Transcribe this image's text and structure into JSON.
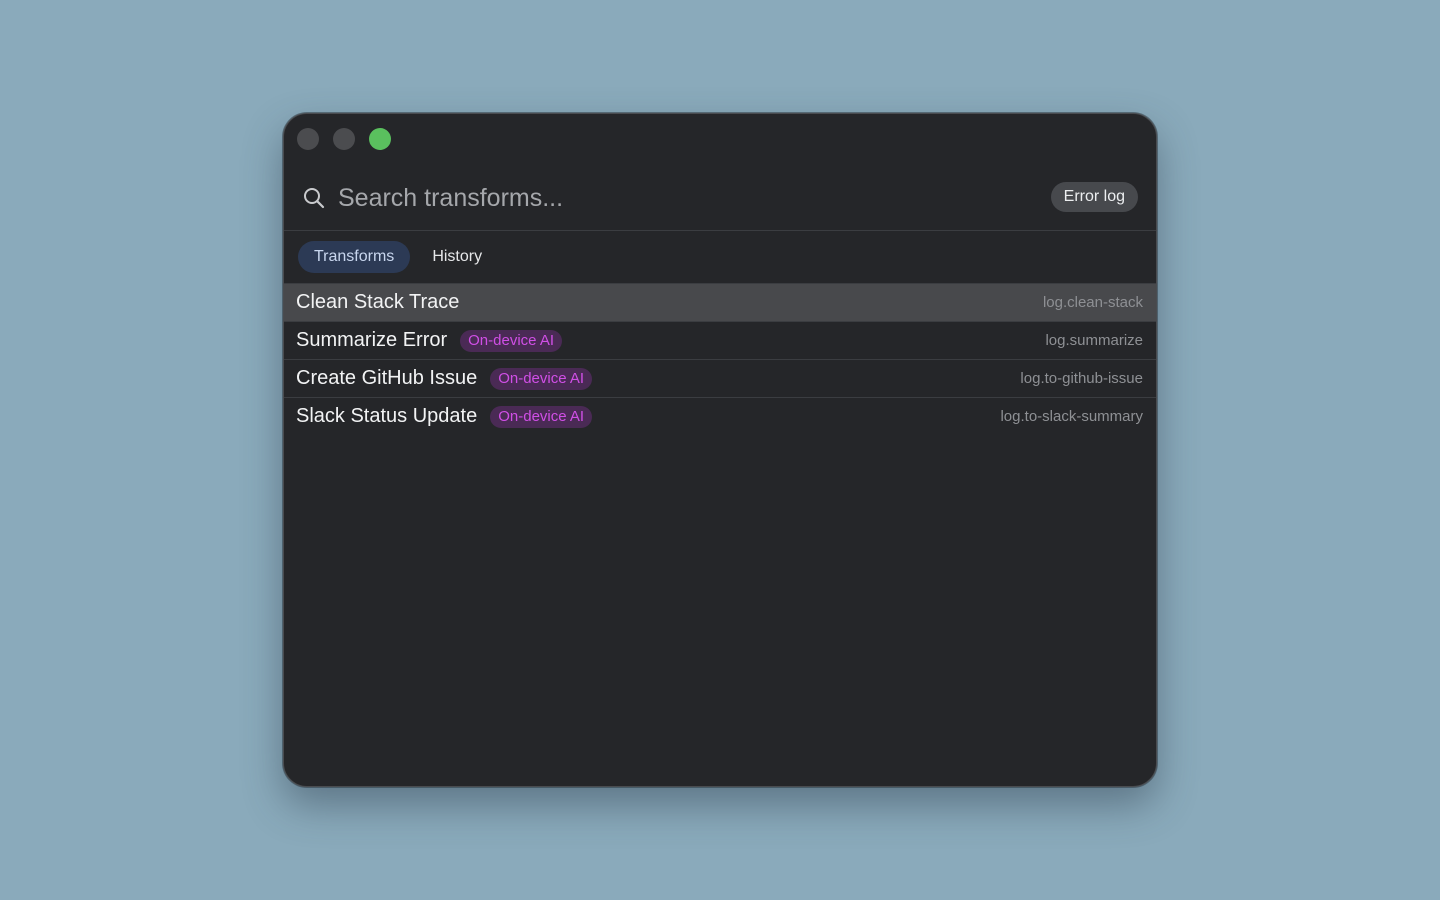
{
  "window": {
    "traffic_lights": [
      "close",
      "minimize",
      "zoom"
    ]
  },
  "search": {
    "placeholder": "Search transforms...",
    "value": "",
    "icon": "search-icon"
  },
  "error_log_button": "Error log",
  "tabs": [
    {
      "label": "Transforms",
      "active": true
    },
    {
      "label": "History",
      "active": false
    }
  ],
  "transforms": [
    {
      "title": "Clean Stack Trace",
      "badge": "",
      "id": "log.clean-stack",
      "selected": true
    },
    {
      "title": "Summarize Error",
      "badge": "On-device AI",
      "id": "log.summarize",
      "selected": false
    },
    {
      "title": "Create GitHub Issue",
      "badge": "On-device AI",
      "id": "log.to-github-issue",
      "selected": false
    },
    {
      "title": "Slack Status Update",
      "badge": "On-device AI",
      "id": "log.to-slack-summary",
      "selected": false
    }
  ],
  "colors": {
    "background": "#8aaabb",
    "window": "#252629",
    "accent_tab": "#2c3a55",
    "badge_text": "#d04fe6",
    "badge_bg": "#4a2a55",
    "traffic_green": "#5ac05e"
  }
}
